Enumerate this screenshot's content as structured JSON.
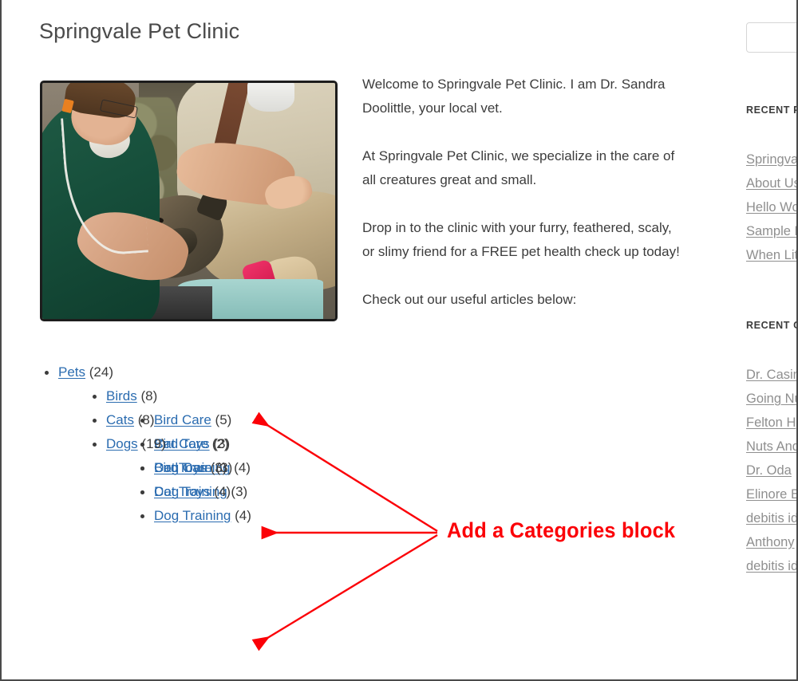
{
  "site": {
    "title": "Springvale Pet Clinic"
  },
  "hero": {
    "alt": "Veterinarian in green scrubs examining a german shepherd dog on an exam table while a person in a tan shirt holds the dog"
  },
  "main": {
    "paragraphs": [
      "Welcome to Springvale Pet Clinic. I am Dr. Sandra Doolittle, your local vet.",
      "At Springvale Pet Clinic, we specialize in the care of all creatures great and small.",
      "Drop in to the clinic with your furry, feathered, scaly, or slimy friend for a FREE pet health check up today!",
      "Check out our useful articles below:"
    ]
  },
  "categories": [
    {
      "label": "Pets",
      "count": "(24)",
      "children": [
        {
          "label": "Birds",
          "count": "(8)",
          "children": [
            {
              "label": "Bird Care",
              "count": "(5)"
            },
            {
              "label": "Bird Toys",
              "count": "(3)"
            },
            {
              "label": "Bird Training",
              "count": "(4)"
            }
          ]
        },
        {
          "label": "Cats",
          "count": "(8)",
          "children": [
            {
              "label": "Cat Care",
              "count": "(2)"
            },
            {
              "label": "Cat Toys",
              "count": "(3)"
            },
            {
              "label": "Cat Training",
              "count": "(3)"
            }
          ]
        },
        {
          "label": "Dogs",
          "count": "(19)",
          "children": [
            {
              "label": "Dog Care",
              "count": "(3)"
            },
            {
              "label": "Dog Toys",
              "count": "(4)"
            },
            {
              "label": "Dog Training",
              "count": "(4)"
            }
          ]
        }
      ]
    }
  ],
  "sidebar": {
    "search": {
      "value": "",
      "placeholder": ""
    },
    "recent_posts": {
      "title": "Recent Posts",
      "items": [
        "Springvale",
        "About Us",
        "Hello World",
        "Sample Page",
        "When Lit"
      ]
    },
    "recent_comments": {
      "title": "Recent Comments",
      "items": [
        "Dr. Casim",
        "Going Nu",
        "Felton H",
        "Nuts And",
        "Dr. Oda",
        "Elinore B",
        "debitis id",
        "Anthony",
        "debitis id"
      ]
    }
  },
  "annotation": {
    "label": "Add a Categories block",
    "color": "#fb0007",
    "arrow_targets": [
      "Bird Care",
      "Cat Toys",
      "Dog Training"
    ]
  }
}
